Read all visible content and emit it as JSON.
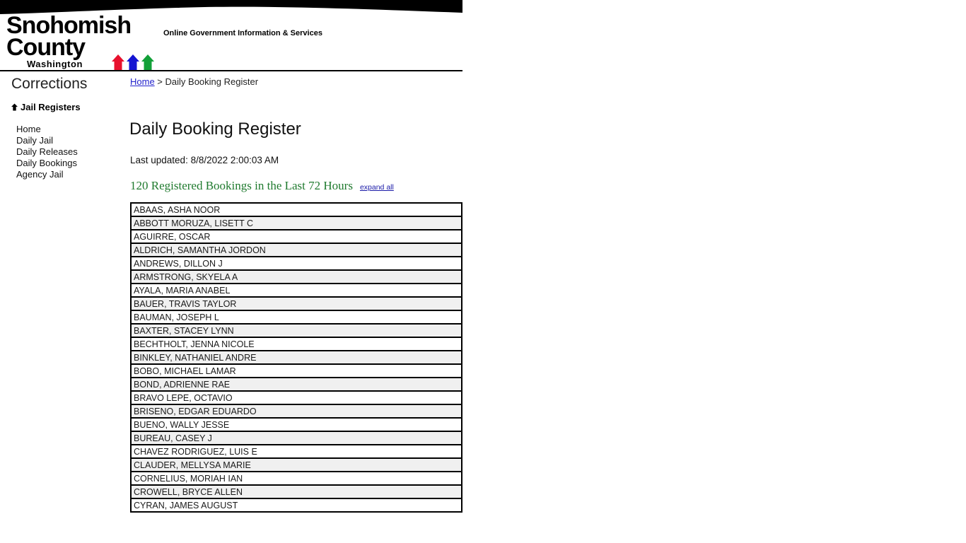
{
  "header": {
    "logo_line1": "Snohomish",
    "logo_line2": "County",
    "logo_state": "Washington",
    "tagline": "Online Government Information & Services",
    "arrow_colors": [
      "#e8112d",
      "#1414d2",
      "#12a038"
    ]
  },
  "sidebar": {
    "department": "Corrections",
    "group_label": "Jail Registers",
    "group_bullet_icon": "arrow-up-icon",
    "items": [
      {
        "label": "Home"
      },
      {
        "label": "Daily Jail"
      },
      {
        "label": "Daily Releases"
      },
      {
        "label": "Daily Bookings"
      },
      {
        "label": "Agency Jail"
      }
    ]
  },
  "breadcrumb": {
    "home_label": "Home",
    "separator": ">",
    "current": "Daily Booking Register"
  },
  "main": {
    "page_title": "Daily Booking Register",
    "last_updated": "Last updated: 8/8/2022 2:00:03 AM",
    "summary": "120 Registered Bookings in the Last 72 Hours",
    "expand_all_label": "expand all",
    "summary_color": "#1f7a2e",
    "link_color": "#1a1aa8",
    "bookings": [
      "ABAAS, ASHA NOOR",
      "ABBOTT MORUZA, LISETT C",
      "AGUIRRE, OSCAR",
      "ALDRICH, SAMANTHA JORDON",
      "ANDREWS, DILLON J",
      "ARMSTRONG, SKYELA A",
      "AYALA, MARIA ANABEL",
      "BAUER, TRAVIS TAYLOR",
      "BAUMAN, JOSEPH L",
      "BAXTER, STACEY LYNN",
      "BECHTHOLT, JENNA NICOLE",
      "BINKLEY, NATHANIEL ANDRE",
      "BOBO, MICHAEL LAMAR",
      "BOND, ADRIENNE RAE",
      "BRAVO LEPE, OCTAVIO",
      "BRISENO, EDGAR EDUARDO",
      "BUENO, WALLY JESSE",
      "BUREAU, CASEY J",
      "CHAVEZ RODRIGUEZ, LUIS E",
      "CLAUDER, MELLYSA MARIE",
      "CORNELIUS, MORIAH IAN",
      "CROWELL, BRYCE ALLEN",
      "CYRAN, JAMES AUGUST"
    ]
  }
}
